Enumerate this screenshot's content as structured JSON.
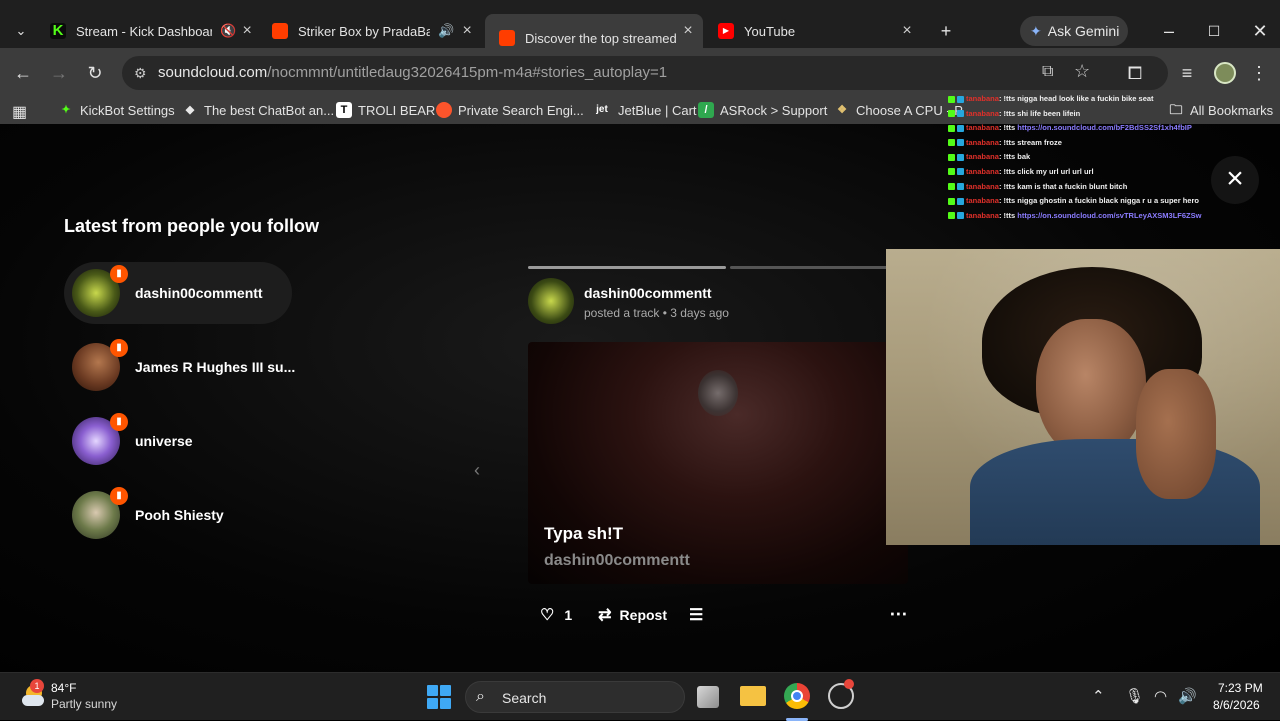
{
  "browser": {
    "tabs": [
      {
        "title": "Stream - Kick Dashboard",
        "favicon": "kick-icon",
        "favicon_color": "#53fc18",
        "audio": "muted-icon"
      },
      {
        "title": "Striker Box by PradaBags",
        "favicon": "soundcloud-icon",
        "favicon_color": "#ff3d00",
        "audio": "speaker-icon"
      },
      {
        "title": "Discover the top streamed m",
        "favicon": "soundcloud-icon",
        "favicon_color": "#ff3d00",
        "active": true
      },
      {
        "title": "YouTube",
        "favicon": "youtube-icon",
        "favicon_color": "#ff0000"
      }
    ],
    "new_tab": "+",
    "gemini_label": "Ask Gemini",
    "address": {
      "host": "soundcloud.com",
      "path": "/nocmmnt/untitledaug32026415pm-m4a#stories_autoplay=1"
    },
    "bookmarks": [
      {
        "label": "KickBot Settings",
        "icon": "kickbot-icon"
      },
      {
        "label": "The best ChatBot an...",
        "icon": "chatbot-icon"
      },
      {
        "label": "TROLI BEAR",
        "icon": "t-icon"
      },
      {
        "label": "Private Search Engi...",
        "icon": "brave-icon"
      },
      {
        "label": "JetBlue | Cart",
        "icon": "jetblue-icon"
      },
      {
        "label": "ASRock > Support",
        "icon": "asrock-icon"
      },
      {
        "label": "Choose A CPU - P",
        "icon": "cpu-icon"
      }
    ],
    "all_bookmarks": "All Bookmarks"
  },
  "page": {
    "section_title": "Latest from people you follow",
    "follows": [
      {
        "name": "dashin00commentt",
        "selected": true
      },
      {
        "name": "James R Hughes III su..."
      },
      {
        "name": "universe"
      },
      {
        "name": "Pooh Shiesty"
      }
    ],
    "story": {
      "user": "dashin00commentt",
      "meta": "posted a track • 3 days ago",
      "track_title": "Typa sh!T",
      "track_artist": "dashin00commentt",
      "likes": "1",
      "repost_label": "Repost",
      "progress": [
        1.0,
        0.0
      ]
    }
  },
  "chat": [
    {
      "user": "tanabana",
      "text": ": !tts nigga head look like a fuckin bike seat"
    },
    {
      "user": "tanabana",
      "text": ": !tts shi life been lifein"
    },
    {
      "user": "tanabana",
      "text": ": !tts ",
      "link": "https://on.soundcloud.com/bF2BdSS2Sf1xh4fbIP"
    },
    {
      "user": "tanabana",
      "text": ": !tts stream froze"
    },
    {
      "user": "tanabana",
      "text": ": !tts bak"
    },
    {
      "user": "tanabana",
      "text": ": !tts click my url url url url"
    },
    {
      "user": "tanabana",
      "text": ": !tts kam is that a fuckin blunt bitch"
    },
    {
      "user": "tanabana",
      "text": ": !tts nigga ghostin a fuckin black nigga r u a super hero"
    },
    {
      "user": "tanabana",
      "text": ": !tts ",
      "link": "https://on.soundcloud.com/svTRLeyAXSM3LF6ZSw"
    }
  ],
  "taskbar": {
    "temp": "84°F",
    "condition": "Partly sunny",
    "weather_badge": "1",
    "search_placeholder": "Search",
    "time": "7:23 PM",
    "date": "8/6/2026"
  }
}
